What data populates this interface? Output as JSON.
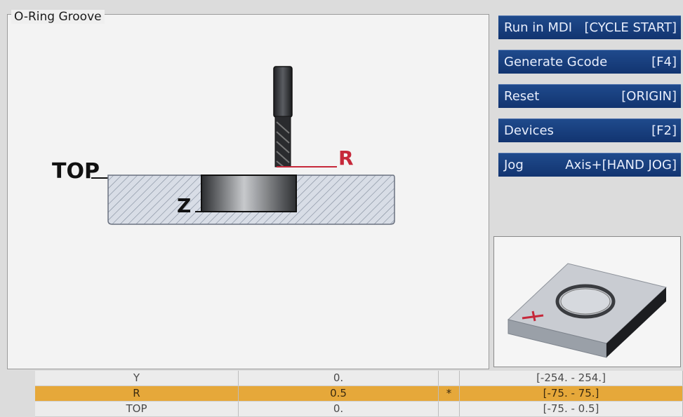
{
  "panel": {
    "title": "O-Ring Groove"
  },
  "diagram": {
    "top_label": "TOP",
    "z_label": "Z",
    "r_label": "R"
  },
  "buttons": [
    {
      "label": "Run in MDI",
      "shortcut": "[CYCLE START]"
    },
    {
      "label": "Generate Gcode",
      "shortcut": "[F4]"
    },
    {
      "label": "Reset",
      "shortcut": "[ORIGIN]"
    },
    {
      "label": "Devices",
      "shortcut": "[F2]"
    },
    {
      "label": "Jog",
      "shortcut": "Axis+[HAND JOG]"
    }
  ],
  "table": {
    "rows": [
      {
        "name": "Y",
        "value": "0.",
        "flag": "",
        "range": "[-254. - 254.]",
        "selected": false
      },
      {
        "name": "R",
        "value": "0.5",
        "flag": "*",
        "range": "[-75. - 75.]",
        "selected": true
      },
      {
        "name": "TOP",
        "value": "0.",
        "flag": "",
        "range": "[-75. - 0.5]",
        "selected": false
      }
    ]
  },
  "colors": {
    "button_bg": "#1a3f80",
    "selected_row": "#e6a83a",
    "r_label": "#c6283a"
  }
}
